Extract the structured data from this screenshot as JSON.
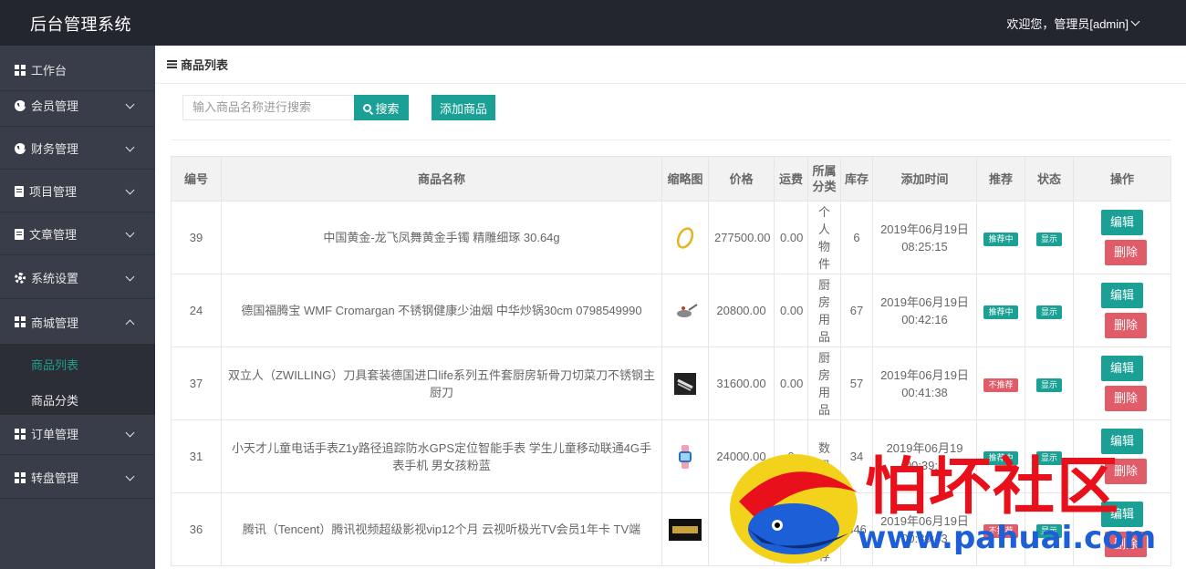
{
  "app": {
    "title": "后台管理系统",
    "user": "欢迎您，管理员[admin]"
  },
  "sidebar": {
    "items": [
      {
        "label": "工作台",
        "icon": "grid-icon"
      },
      {
        "label": "会员管理",
        "icon": "v-circle-icon"
      },
      {
        "label": "财务管理",
        "icon": "yen-circle-icon"
      },
      {
        "label": "项目管理",
        "icon": "document-icon"
      },
      {
        "label": "文章管理",
        "icon": "file-icon"
      },
      {
        "label": "系统设置",
        "icon": "gear-icon"
      },
      {
        "label": "商城管理",
        "icon": "grid-icon"
      },
      {
        "label": "订单管理",
        "icon": "grid-icon"
      },
      {
        "label": "转盘管理",
        "icon": "grid-icon"
      }
    ],
    "sub_items": [
      {
        "label": "商品列表",
        "active": true
      },
      {
        "label": "商品分类",
        "active": false
      }
    ]
  },
  "panel": {
    "title": "商品列表"
  },
  "toolbar": {
    "search_placeholder": "输入商品名称进行搜索",
    "search_label": "搜索",
    "add_label": "添加商品"
  },
  "table": {
    "headers": [
      "编号",
      "商品名称",
      "缩略图",
      "价格",
      "运费",
      "所属分类",
      "库存",
      "添加时间",
      "推荐",
      "状态",
      "操作"
    ],
    "rows": [
      {
        "id": "39",
        "name": "中国黄金-龙飞凤舞黄金手镯 精雕细琢 30.64g",
        "price": "277500.00",
        "freight": "0.00",
        "category": "个人物件",
        "stock": "6",
        "date": "2019年06月19日",
        "time": "08:25:15",
        "recommend": "推荐中",
        "recommend_color": "#1aa094",
        "status": "显示",
        "thumb": "gold-bracelet"
      },
      {
        "id": "24",
        "name": "德国福腾宝 WMF Cromargan 不锈钢健康少油烟 中华炒锅30cm 0798549990",
        "price": "20800.00",
        "freight": "0.00",
        "category": "厨房用品",
        "stock": "67",
        "date": "2019年06月19日",
        "time": "00:42:16",
        "recommend": "推荐中",
        "recommend_color": "#1aa094",
        "status": "显示",
        "thumb": "wok"
      },
      {
        "id": "37",
        "name": "双立人（ZWILLING）刀具套装德国进口life系列五件套厨房斩骨刀切菜刀不锈钢主厨刀",
        "price": "31600.00",
        "freight": "0.00",
        "category": "厨房用品",
        "stock": "57",
        "date": "2019年06月19日",
        "time": "00:41:38",
        "recommend": "不推荐",
        "recommend_color": "#e05c68",
        "status": "显示",
        "thumb": "knife-set"
      },
      {
        "id": "31",
        "name": "小天才儿童电话手表Z1y路径追踪防水GPS定位智能手表 学生儿童移动联通4G手表手机 男女孩粉蓝",
        "price": "24000.00",
        "freight": "0",
        "category": "数码",
        "stock": "34",
        "date": "2019年06月19",
        "time": "00:39:5",
        "recommend": "推荐中",
        "recommend_color": "#1aa094",
        "status": "显示",
        "thumb": "smart-watch"
      },
      {
        "id": "36",
        "name": "腾讯（Tencent）腾讯视频超级影视vip12个月 云视听极光TV会员1年卡 TV端",
        "price": "1",
        "freight": "",
        "category": "精选推荐",
        "stock": "346",
        "date": "2019年06月19日",
        "time": "00:39:43",
        "recommend": "不推荐",
        "recommend_color": "#e05c68",
        "status": "显示",
        "thumb": "tv-vip-card"
      }
    ],
    "actions": {
      "edit": "编辑",
      "delete": "删除"
    }
  },
  "watermark": {
    "text": "怕坏社区",
    "url": "www.pahuai.com"
  }
}
